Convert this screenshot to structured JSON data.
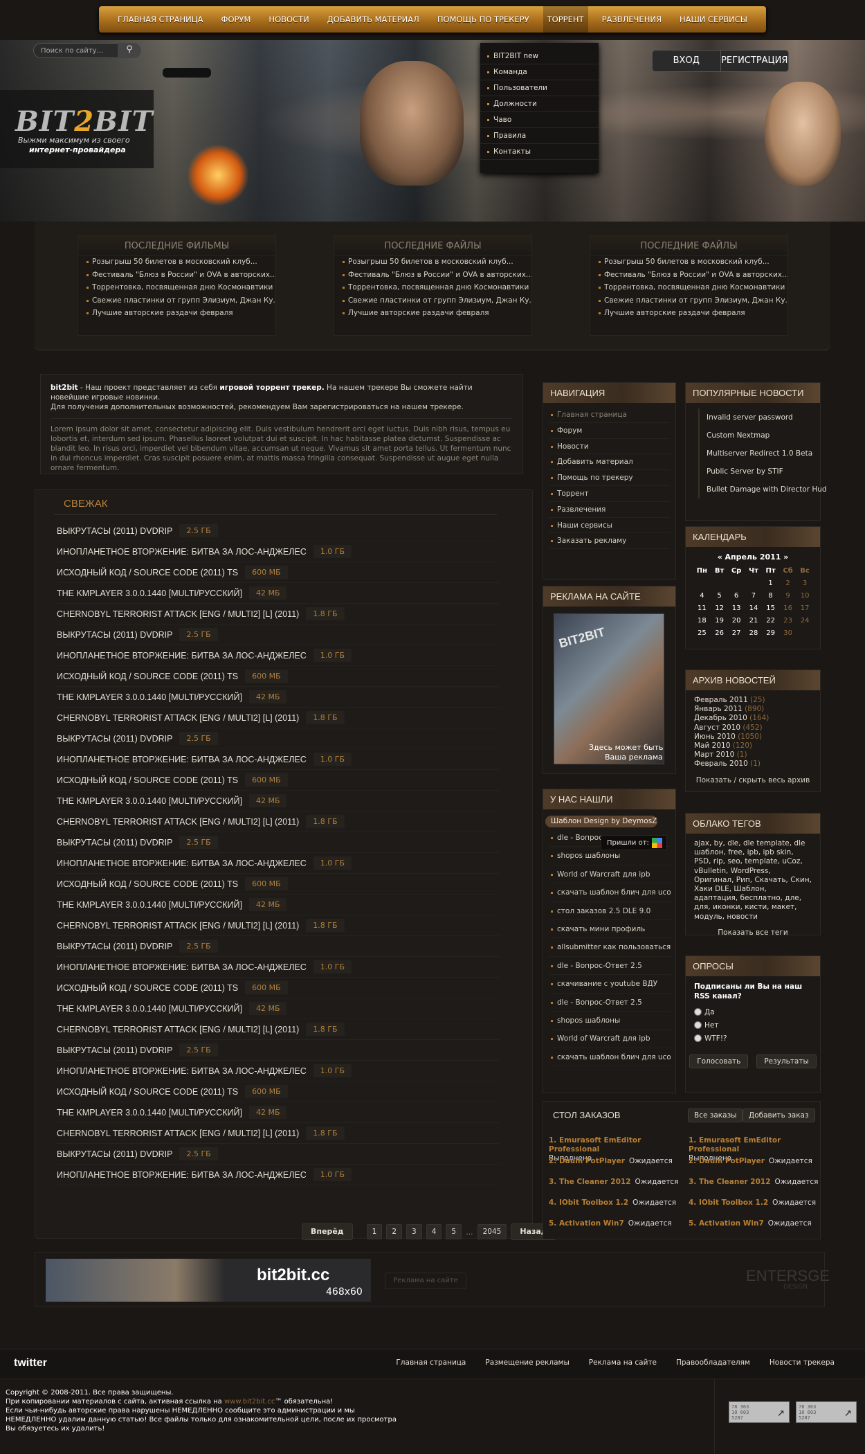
{
  "nav": [
    "ГЛАВНАЯ СТРАНИЦА",
    "ФОРУМ",
    "НОВОСТИ",
    "ДОБАВИТЬ МАТЕРИАЛ",
    "ПОМОЩЬ ПО ТРЕКЕРУ",
    "ТОРРЕНТ",
    "РАЗВЛЕЧЕНИЯ",
    "НАШИ СЕРВИСЫ"
  ],
  "dropdown": [
    "BIT2BIT new",
    "Команда",
    "Пользователи",
    "Должности",
    "Чаво",
    "Правила",
    "Контакты"
  ],
  "header": {
    "search_placeholder": "Поиск по сайту...",
    "logo_a": "BIT",
    "logo_b": "2",
    "logo_c": "BIT",
    "slogan1": "Выжми максимум из своего",
    "slogan2": "интернет-провайдера",
    "login": "ВХОД",
    "register": "РЕГИСТРАЦИЯ"
  },
  "latest": [
    {
      "title": "ПОСЛЕДНИЕ ФИЛЬМЫ",
      "items": [
        "Розыгрыш 50 билетов в московский клуб...",
        "Фестиваль \"Блюз в России\" и OVA в авторских...",
        "Торрентовка, посвященная дню Космонавтики",
        "Свежие пластинки от групп Элизиум, Джан Ку...",
        "Лучшие авторские раздачи февраля"
      ]
    },
    {
      "title": "ПОСЛЕДНИЕ ФАЙЛЫ",
      "items": [
        "Розыгрыш 50 билетов в московский клуб...",
        "Фестиваль \"Блюз в России\" и OVA в авторских...",
        "Торрентовка, посвященная дню Космонавтики",
        "Свежие пластинки от групп Элизиум, Джан Ку...",
        "Лучшие авторские раздачи февраля"
      ]
    },
    {
      "title": "ПОСЛЕДНИЕ ФАЙЛЫ",
      "items": [
        "Розыгрыш 50 билетов в московский клуб...",
        "Фестиваль \"Блюз в России\" и OVA в авторских...",
        "Торрентовка, посвященная дню Космонавтики",
        "Свежие пластинки от групп Элизиум, Джан Ку...",
        "Лучшие авторские раздачи февраля"
      ]
    }
  ],
  "about": {
    "brand": "bit2bit",
    "t1": " - Наш проект представляет из себя ",
    "bold": "игровой торрент трекер.",
    "t2": " На нашем трекере Вы сможете найти новейшие игровые новинки.",
    "t3": "Для получения дополнительных возможностей, рекомендуем Вам зарегистрироваться на нашем трекере.",
    "lorem": "Lorem ipsum dolor sit amet, consectetur adipiscing elit. Duis vestibulum hendrerit orci eget luctus. Duis nibh risus, tempus eu lobortis et, interdum sed ipsum. Phasellus laoreet volutpat dui et suscipit. In hac habitasse platea dictumst. Suspendisse ac blandit leo. In risus orci, imperdiet vel bibendum vitae, accumsan ut neque. Vivamus sit amet porta tellus. Ut fermentum nunc in dui rhoncus imperdiet. Cras suscipit posuere enim, at mattis massa fringilla consequat. Suspendisse ut augue eget nulla ornare fermentum."
  },
  "fresh": {
    "title": "СВЕЖАК",
    "items": [
      [
        "ВЫКРУТАСЫ (2011) DVDRIP",
        "2.5 ГБ"
      ],
      [
        "ИНОПЛАНЕТНОЕ ВТОРЖЕНИЕ: БИТВА ЗА ЛОС-АНДЖЕЛЕС",
        "1.0 ГБ"
      ],
      [
        "ИСХОДНЫЙ КОД / SOURCE CODE (2011) TS",
        "600 МБ"
      ],
      [
        "THE KMPLAYER 3.0.0.1440 [MULTI/РУССКИЙ]",
        "42 МБ"
      ],
      [
        "CHERNOBYL TERRORIST ATTACK [ENG / MULTI2] [L] (2011)",
        "1.8 ГБ"
      ],
      [
        "ВЫКРУТАСЫ (2011) DVDRIP",
        "2.5 ГБ"
      ],
      [
        "ИНОПЛАНЕТНОЕ ВТОРЖЕНИЕ: БИТВА ЗА ЛОС-АНДЖЕЛЕС",
        "1.0 ГБ"
      ],
      [
        "ИСХОДНЫЙ КОД / SOURCE CODE (2011) TS",
        "600 МБ"
      ],
      [
        "THE KMPLAYER 3.0.0.1440 [MULTI/РУССКИЙ]",
        "42 МБ"
      ],
      [
        "CHERNOBYL TERRORIST ATTACK [ENG / MULTI2] [L] (2011)",
        "1.8 ГБ"
      ],
      [
        "ВЫКРУТАСЫ (2011) DVDRIP",
        "2.5 ГБ"
      ],
      [
        "ИНОПЛАНЕТНОЕ ВТОРЖЕНИЕ: БИТВА ЗА ЛОС-АНДЖЕЛЕС",
        "1.0 ГБ"
      ],
      [
        "ИСХОДНЫЙ КОД / SOURCE CODE (2011) TS",
        "600 МБ"
      ],
      [
        "THE KMPLAYER 3.0.0.1440 [MULTI/РУССКИЙ]",
        "42 МБ"
      ],
      [
        "CHERNOBYL TERRORIST ATTACK [ENG / MULTI2] [L] (2011)",
        "1.8 ГБ"
      ],
      [
        "ВЫКРУТАСЫ (2011) DVDRIP",
        "2.5 ГБ"
      ],
      [
        "ИНОПЛАНЕТНОЕ ВТОРЖЕНИЕ: БИТВА ЗА ЛОС-АНДЖЕЛЕС",
        "1.0 ГБ"
      ],
      [
        "ИСХОДНЫЙ КОД / SOURCE CODE (2011) TS",
        "600 МБ"
      ],
      [
        "THE KMPLAYER 3.0.0.1440 [MULTI/РУССКИЙ]",
        "42 МБ"
      ],
      [
        "CHERNOBYL TERRORIST ATTACK [ENG / MULTI2] [L] (2011)",
        "1.8 ГБ"
      ],
      [
        "ВЫКРУТАСЫ (2011) DVDRIP",
        "2.5 ГБ"
      ],
      [
        "ИНОПЛАНЕТНОЕ ВТОРЖЕНИЕ: БИТВА ЗА ЛОС-АНДЖЕЛЕС",
        "1.0 ГБ"
      ],
      [
        "ИСХОДНЫЙ КОД / SOURCE CODE (2011) TS",
        "600 МБ"
      ],
      [
        "THE KMPLAYER 3.0.0.1440 [MULTI/РУССКИЙ]",
        "42 МБ"
      ],
      [
        "CHERNOBYL TERRORIST ATTACK [ENG / MULTI2] [L] (2011)",
        "1.8 ГБ"
      ],
      [
        "ВЫКРУТАСЫ (2011) DVDRIP",
        "2.5 ГБ"
      ],
      [
        "ИНОПЛАНЕТНОЕ ВТОРЖЕНИЕ: БИТВА ЗА ЛОС-АНДЖЕЛЕС",
        "1.0 ГБ"
      ],
      [
        "ИСХОДНЫЙ КОД / SOURCE CODE (2011) TS",
        "600 МБ"
      ],
      [
        "THE KMPLAYER 3.0.0.1440 [MULTI/РУССКИЙ]",
        "42 МБ"
      ],
      [
        "CHERNOBYL TERRORIST ATTACK [ENG / MULTI2] [L] (2011)",
        "1.8 ГБ"
      ],
      [
        "ВЫКРУТАСЫ (2011) DVDRIP",
        "2.5 ГБ"
      ],
      [
        "ИНОПЛАНЕТНОЕ ВТОРЖЕНИЕ: БИТВА ЗА ЛОС-АНДЖЕЛЕС",
        "1.0 ГБ"
      ]
    ]
  },
  "pager": {
    "next": "Вперёд",
    "pages": [
      "1",
      "2",
      "3",
      "4",
      "5"
    ],
    "dots": "...",
    "last": "2045",
    "prev": "Назад"
  },
  "banner": {
    "text": "bit2bit.cc",
    "size": "468x60",
    "slot": "Реклама на сайте",
    "brand": "ENTERSGE",
    "brand_sub": "DESIGN"
  },
  "navigation": {
    "title": "НАВИГАЦИЯ",
    "items": [
      "Главная страница",
      "Форум",
      "Новости",
      "Добавить материал",
      "Помощь по трекеру",
      "Торрент",
      "Развлечения",
      "Наши сервисы",
      "Заказать рекламу"
    ]
  },
  "popular": {
    "title": "ПОПУЛЯРНЫЕ НОВОСТИ",
    "items": [
      "Invalid server password",
      "Custom Nextmap",
      "Multiserver Redirect 1.0 Beta",
      "Public Server by STIF",
      "Bullet Damage with Director Hud"
    ]
  },
  "ad": {
    "title": "РЕКЛАМА НА САЙТЕ",
    "logo": "BIT2BIT",
    "line1": "Здесь может быть",
    "line2": "Ваша реклама"
  },
  "calendar": {
    "title": "КАЛЕНДАРЬ",
    "month": "«     Апрель 2011     »",
    "days": [
      "Пн",
      "Вт",
      "Ср",
      "Чт",
      "Пт",
      "Сб",
      "Вс"
    ],
    "weeks": [
      [
        "",
        "",
        "",
        "",
        "1",
        "2",
        "3"
      ],
      [
        "4",
        "5",
        "6",
        "7",
        "8",
        "9",
        "10"
      ],
      [
        "11",
        "12",
        "13",
        "14",
        "15",
        "16",
        "17"
      ],
      [
        "18",
        "19",
        "20",
        "21",
        "22",
        "23",
        "24"
      ],
      [
        "25",
        "26",
        "27",
        "28",
        "29",
        "30",
        ""
      ]
    ]
  },
  "archive": {
    "title": "АРХИВ НОВОСТЕЙ",
    "items": [
      [
        "Февраль 2011",
        "(25)"
      ],
      [
        "Январь 2011",
        "(890)"
      ],
      [
        "Декабрь 2010",
        "(164)"
      ],
      [
        "Август 2010",
        "(452)"
      ],
      [
        "Июнь 2010",
        "(1050)"
      ],
      [
        "Май 2010",
        "(120)"
      ],
      [
        "Март 2010",
        "(1)"
      ],
      [
        "Февраль 2010",
        "(1)"
      ]
    ],
    "more": "Показать / скрыть весь архив"
  },
  "found": {
    "title": "У НАС НАШЛИ",
    "tag": "Шаблон Design by DeymosZ",
    "come": "Пришли от:",
    "items": [
      "dle - Вопрос",
      "shopos шаблоны",
      "World of Warcraft для ipb",
      "скачать шаблон блич для ucoz",
      "стол заказов 2.5 DLE 9.0",
      "скачать мини профиль",
      "allsubmitter как пользоваться",
      "dle - Вопрос-Ответ 2.5",
      "скачивание с youtube ВДУ",
      "dle - Вопрос-Ответ 2.5",
      "shopos шаблоны",
      "World of Warcraft для ipb",
      "скачать шаблон блич для ucoz"
    ]
  },
  "tags": {
    "title": "ОБЛАКО ТЕГОВ",
    "text": "ajax, by, dle, dle template, dle шаблон, free, ipb, ipb skin, PSD, rip, seo, template, uCoz, vBulletin, WordPress, Оригинал, Рип, Скачать, Скин, Хаки DLE, Шаблон, адаптация, бесплатно, дле, для, иконки, кисти, макет, модуль, новости",
    "more": "Показать все теги"
  },
  "poll": {
    "title": "ОПРОСЫ",
    "question": "Подписаны ли Вы на наш RSS канал?",
    "options": [
      "Да",
      "Нет",
      "WTF!?"
    ],
    "vote": "Голосовать",
    "results": "Результаты"
  },
  "orders": {
    "title": "СТОЛ ЗАКАЗОВ",
    "all": "Все заказы",
    "add": "Добавить заказ",
    "left": [
      [
        "1. Emurasoft EmEditor Professional",
        "Выполнено"
      ],
      [
        "2. Daum PotPlayer",
        "Ожидается"
      ],
      [
        "3. The Cleaner 2012",
        "Ожидается"
      ],
      [
        "4. IObit Toolbox 1.2",
        "Ожидается"
      ],
      [
        "5. Activation Win7",
        "Ожидается"
      ]
    ],
    "right": [
      [
        "1. Emurasoft EmEditor Professional",
        "Выполнено"
      ],
      [
        "2. Daum PotPlayer",
        "Ожидается"
      ],
      [
        "3. The Cleaner 2012",
        "Ожидается"
      ],
      [
        "4. IObit Toolbox 1.2",
        "Ожидается"
      ],
      [
        "5. Activation Win7",
        "Ожидается"
      ]
    ]
  },
  "footer": {
    "twitter": "twitter",
    "links": [
      "Главная страница",
      "Размещение рекламы",
      "Реклама на сайте",
      "Правообладателям",
      "Новости трекера"
    ],
    "c1": "Copyright © 2008-2011. Все права защищены.",
    "c2a": "При копировании материалов с сайта, активная ссылка на ",
    "c2link": "www.bit2bit.cc",
    "c2b": "™ обязательна!",
    "c3": "Если чьи-нибудь авторские права нарушены НЕМЕДЛЕННО сообщите это администрации и мы НЕМЕДЛЕННО удалим данную статью! Все файлы только для ознакомительной цели, после их просмотра Вы обязуетесь их удалить!",
    "counter": "78 363\n10 603\n5287"
  }
}
